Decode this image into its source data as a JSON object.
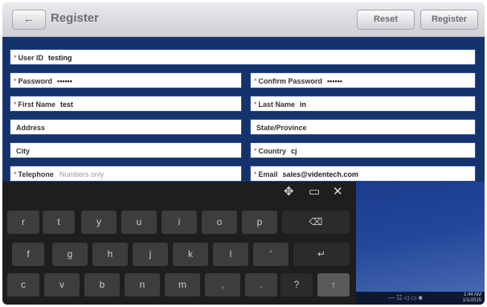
{
  "header": {
    "back_glyph": "←",
    "title": "Register",
    "reset_label": "Reset",
    "register_label": "Register"
  },
  "form": {
    "required_marker": "*",
    "user_id": {
      "label": "User ID",
      "value": "testing"
    },
    "password": {
      "label": "Password",
      "value": "••••••"
    },
    "confirm_password": {
      "label": "Confirm Password",
      "value": "••••••"
    },
    "first_name": {
      "label": "First Name",
      "value": "test"
    },
    "last_name": {
      "label": "Last Name",
      "value": "in"
    },
    "address": {
      "label": "Address",
      "value": ""
    },
    "state_province": {
      "label": "State/Province",
      "value": ""
    },
    "city": {
      "label": "City",
      "value": ""
    },
    "country": {
      "label": "Country",
      "value": "cj"
    },
    "telephone": {
      "label": "Telephone",
      "placeholder": "Numbers only"
    },
    "email": {
      "label": "Email",
      "value": "sales@videntech.com"
    }
  },
  "keyboard": {
    "toolbar": {
      "move": "✥",
      "dock": "▭",
      "close": "✕"
    },
    "keys": {
      "r": "r",
      "t": "t",
      "y": "y",
      "u": "u",
      "i": "i",
      "o": "o",
      "p": "p",
      "backspace": "⌫",
      "f": "f",
      "g": "g",
      "h": "h",
      "j": "j",
      "k": "k",
      "l": "l",
      "apostrophe": "'",
      "enter": "↵",
      "c": "c",
      "v": "v",
      "b": "b",
      "n": "n",
      "m": "m",
      "comma": ",",
      "period": ".",
      "question": "?",
      "shift": "↑"
    }
  },
  "desktop": {
    "taskbar_tray": "— ☷ ◁ ▭ ■",
    "clock_time": "1:44 AM",
    "clock_date": "1/1/2015"
  }
}
